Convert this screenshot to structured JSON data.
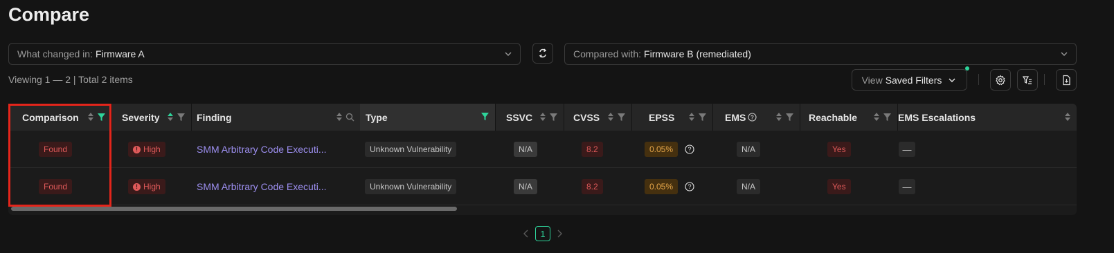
{
  "page": {
    "title": "Compare"
  },
  "compare": {
    "left_prefix": "What changed in:",
    "left_value": "Firmware A",
    "right_prefix": "Compared with:",
    "right_value": "Firmware B (remediated)"
  },
  "toolbar": {
    "viewing_text": "Viewing 1 — 2 | Total 2 items",
    "view_prefix": "View",
    "saved_filters_label": "Saved Filters"
  },
  "table": {
    "columns": {
      "comparison": "Comparison",
      "severity": "Severity",
      "finding": "Finding",
      "type": "Type",
      "ssvc": "SSVC",
      "cvss": "CVSS",
      "epss": "EPSS",
      "ems": "EMS",
      "reachable": "Reachable",
      "ems_escalations": "EMS Escalations"
    },
    "rows": [
      {
        "comparison": "Found",
        "severity": "High",
        "finding": "SMM Arbitrary Code Executi...",
        "type": "Unknown Vulnerability",
        "ssvc": "N/A",
        "cvss": "8.2",
        "epss": "0.05%",
        "ems": "N/A",
        "reachable": "Yes",
        "ems_escalations": "—"
      },
      {
        "comparison": "Found",
        "severity": "High",
        "finding": "SMM Arbitrary Code Executi...",
        "type": "Unknown Vulnerability",
        "ssvc": "N/A",
        "cvss": "8.2",
        "epss": "0.05%",
        "ems": "N/A",
        "reachable": "Yes",
        "ems_escalations": "—"
      }
    ]
  },
  "pagination": {
    "current_page": "1"
  },
  "colors": {
    "accent_green": "#2ed39a",
    "danger_red": "#e05a5a",
    "warning_orange": "#e8a84a",
    "link_purple": "#9d8ff0",
    "highlight_red": "#e4251b"
  },
  "icons": {
    "swap": "swap-arrows-icon",
    "settings": "gear-icon",
    "filter_list": "filter-list-icon",
    "export": "export-file-icon",
    "sort": "sort-icon",
    "filter": "filter-icon",
    "search": "search-icon",
    "info": "info-circle-icon",
    "chevron": "chevron-down-icon"
  }
}
